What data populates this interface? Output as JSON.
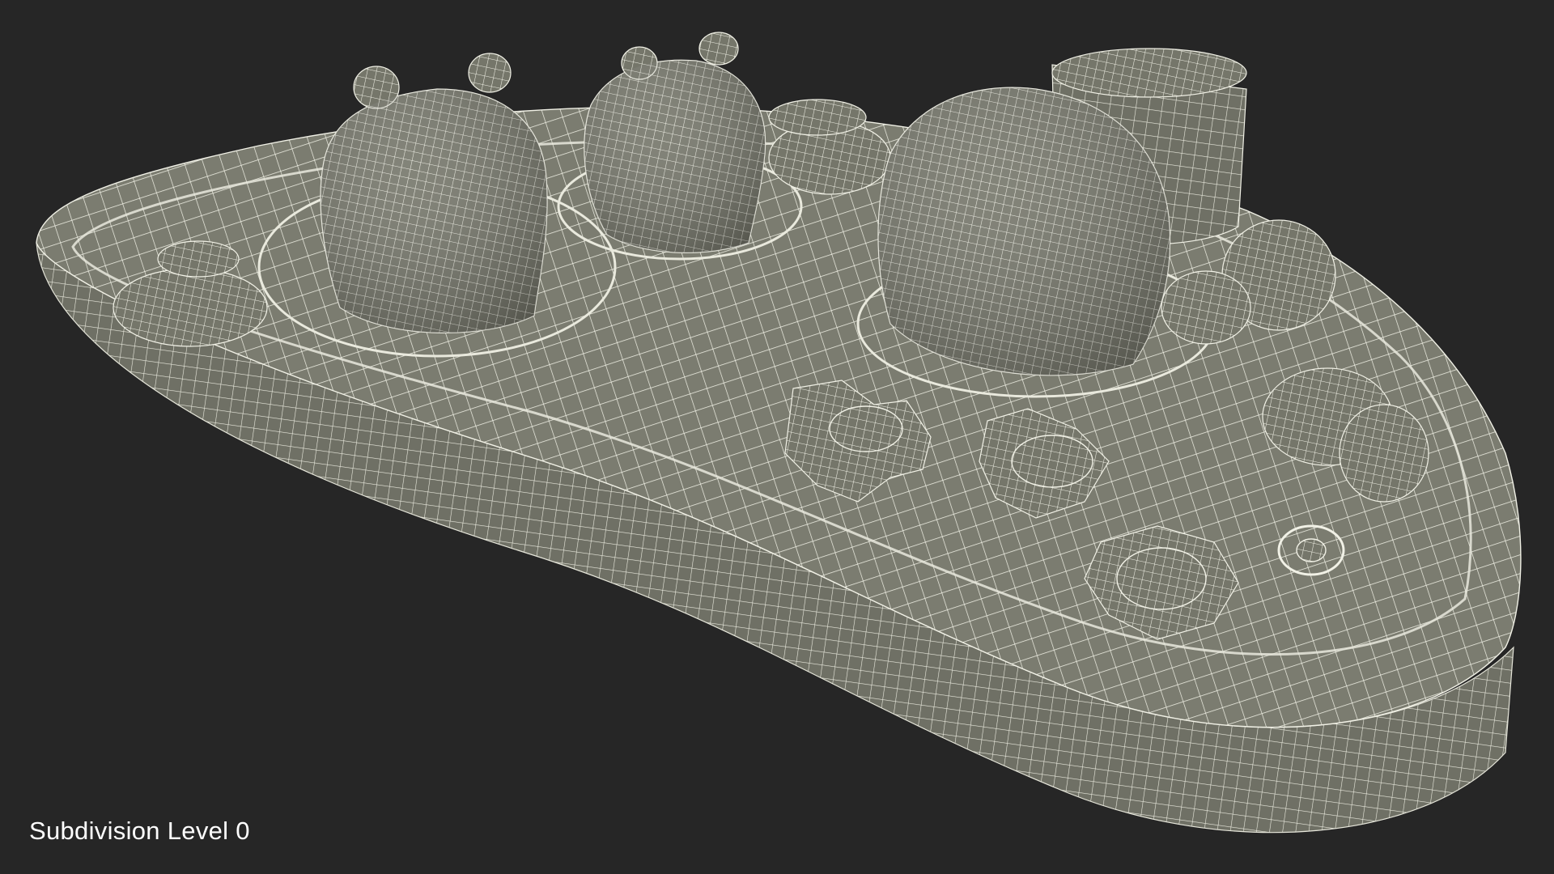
{
  "viewport": {
    "caption": "Subdivision Level 0",
    "background_color": "#262626",
    "model_fill_color": "#7b7c70",
    "wire_color": "#f1f1e6"
  }
}
